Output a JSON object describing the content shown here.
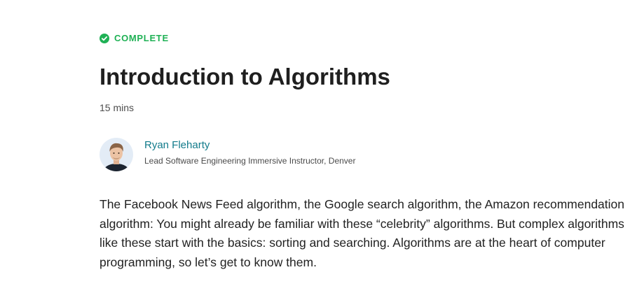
{
  "lesson": {
    "status_label": "COMPLETE",
    "status_icon": "check-circle-icon",
    "status_color": "#1fb155",
    "title": "Introduction to Algorithms",
    "duration": "15 mins"
  },
  "author": {
    "name": "Ryan Fleharty",
    "role": "Lead Software Engineering Immersive Instructor, Denver",
    "name_color": "#127b8b"
  },
  "intro": {
    "text": "The Facebook News Feed algorithm, the Google search algorithm, the Amazon recommendation algorithm: You might already be familiar with these “celebrity” algorithms. But complex algorithms like these start with the basics: sorting and searching. Algorithms are at the heart of computer programming, so let’s get to know them."
  }
}
